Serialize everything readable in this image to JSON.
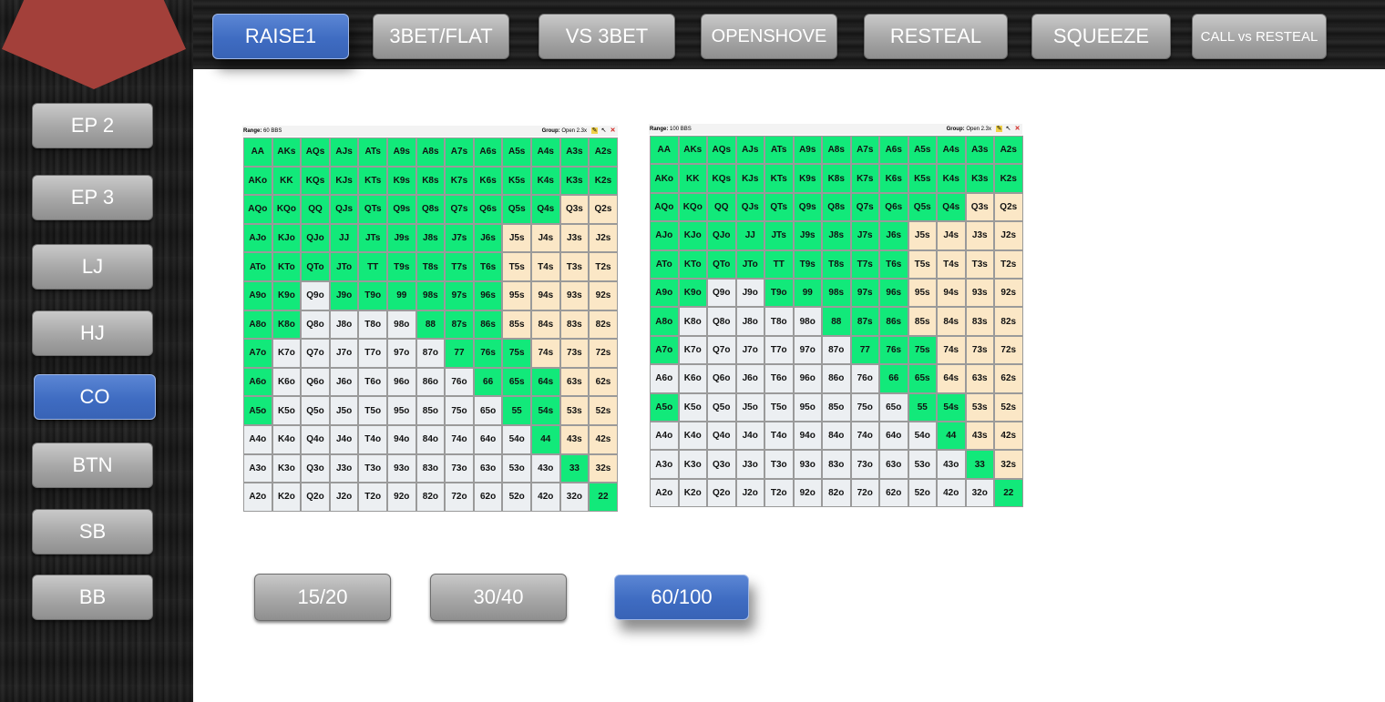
{
  "colors": {
    "raise": "#12e97a",
    "mixed": "#fbe7c6",
    "fold": "#eceff2",
    "active": "#3f6cc2",
    "inactive": "#a8a8a8"
  },
  "header": {
    "logo": "red-pentagon-logo"
  },
  "top_tabs": [
    {
      "label": "RAISE1",
      "active": true
    },
    {
      "label": "3BET/FLAT",
      "active": false
    },
    {
      "label": "VS 3BET",
      "active": false
    },
    {
      "label": "OPENSHOVE",
      "active": false
    },
    {
      "label": "RESTEAL",
      "active": false
    },
    {
      "label": "SQUEEZE",
      "active": false
    },
    {
      "label": "CALL vs RESTEAL",
      "active": false
    }
  ],
  "positions": [
    {
      "label": "EP 2",
      "active": false
    },
    {
      "label": "EP 3",
      "active": false
    },
    {
      "label": "LJ",
      "active": false
    },
    {
      "label": "HJ",
      "active": false
    },
    {
      "label": "CO",
      "active": true
    },
    {
      "label": "BTN",
      "active": false
    },
    {
      "label": "SB",
      "active": false
    },
    {
      "label": "BB",
      "active": false
    }
  ],
  "stacks": [
    {
      "label": "15/20",
      "active": false
    },
    {
      "label": "30/40",
      "active": false
    },
    {
      "label": "60/100",
      "active": true
    }
  ],
  "grids": [
    {
      "range_label": "Range:",
      "range_value": "60 BBS",
      "group_label": "Group:",
      "group_value": "Open 2.3x",
      "rows": [
        "RRRRRRRRRRRRR",
        "RRRRRRRRRRRRR",
        "RRRRRRRRRRRMM",
        "RRRRRRRRRMMMM",
        "RRRRRRRRRMMMM",
        "RRFRRRRRRMMMM",
        "RRFFFFRRRMMMM",
        "RFFFFFFRRRMMM",
        "RFFFFFFFRRRMM",
        "RFFFFFFFFRRMM",
        "FFFFFFFFFFRMM",
        "FFFFFFFFFFFRM",
        "FFFFFFFFFFFFR"
      ]
    },
    {
      "range_label": "Range:",
      "range_value": "100 BBS",
      "group_label": "Group:",
      "group_value": "Open 2.3x",
      "rows": [
        "RRRRRRRRRRRRR",
        "RRRRRRRRRRRRR",
        "RRRRRRRRRRRMM",
        "RRRRRRRRRMMMM",
        "RRRRRRRRRMMMM",
        "RRFFRRRRRMMMM",
        "RFFFFFRRRMMMM",
        "RFFFFFFRRRMMM",
        "FFFFFFFFRRMMM",
        "RFFFFFFFFRRMM",
        "FFFFFFFFFFRMM",
        "FFFFFFFFFFFRM",
        "FFFFFFFFFFFFR"
      ]
    }
  ],
  "ranks": [
    "A",
    "K",
    "Q",
    "J",
    "T",
    "9",
    "8",
    "7",
    "6",
    "5",
    "4",
    "3",
    "2"
  ]
}
